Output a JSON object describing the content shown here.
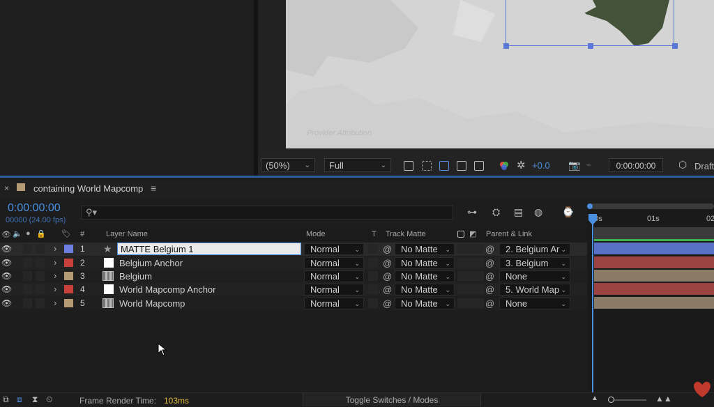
{
  "viewer": {
    "attribution": "Provider Attribution",
    "zoom": "(50%)",
    "resolution": "Full",
    "exposure": "+0.0",
    "timecode": "0:00:00:00",
    "renderer": "Draft"
  },
  "timeline": {
    "tab_title": "containing World Mapcomp",
    "current_time": "0:00:00:00",
    "fps_label": "00000 (24.00 fps)",
    "ruler_labels": [
      "00s",
      "01s",
      "02"
    ]
  },
  "columns": {
    "number": "#",
    "layer_name": "Layer Name",
    "mode": "Mode",
    "t": "T",
    "track_matte": "Track Matte",
    "parent_link": "Parent & Link"
  },
  "colors": {
    "accent": "#4a8fe0",
    "label_blue": "#6c7fe0",
    "label_red": "#c8403a",
    "label_tan": "#b59a74",
    "bar_blue": "#5770c4",
    "bar_red": "#9b4340",
    "bar_tan": "#8a7b66"
  },
  "layers": [
    {
      "num": "1",
      "name": "MATTE Belgium 1",
      "editing": true,
      "label": "blue",
      "mode": "Normal",
      "matte": "No Matte",
      "parent": "2. Belgium Ar",
      "icon": "star-icon"
    },
    {
      "num": "2",
      "name": "Belgium Anchor",
      "label": "red",
      "mode": "Normal",
      "matte": "No Matte",
      "parent": "3. Belgium",
      "icon": "solid-icon"
    },
    {
      "num": "3",
      "name": "Belgium",
      "label": "tan",
      "mode": "Normal",
      "matte": "No Matte",
      "parent": "None",
      "icon": "comp-icon"
    },
    {
      "num": "4",
      "name": "World Mapcomp Anchor",
      "label": "red",
      "mode": "Normal",
      "matte": "No Matte",
      "parent": "5. World Map",
      "icon": "solid-icon"
    },
    {
      "num": "5",
      "name": "World Mapcomp",
      "label": "tan",
      "mode": "Normal",
      "matte": "No Matte",
      "parent": "None",
      "icon": "comp-icon"
    }
  ],
  "footer": {
    "frame_render_label": "Frame Render Time:",
    "frame_render_value": "103ms",
    "toggle_label": "Toggle Switches / Modes"
  }
}
